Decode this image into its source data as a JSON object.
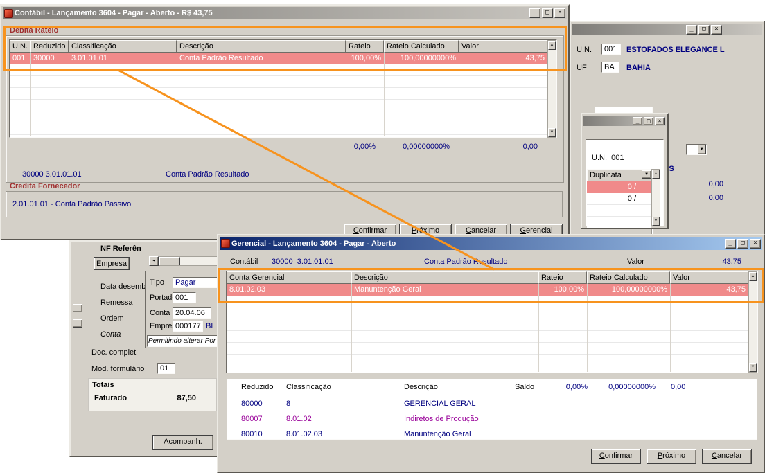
{
  "glyphs": {
    "minimize": "_",
    "maximize": "□",
    "close": "×",
    "up": "▲",
    "down": "▼",
    "left": "◄"
  },
  "colors": {
    "annotation": "#F7931E",
    "pink_row": "#F08A8A",
    "navy_text": "#000080",
    "purple_text": "#990099",
    "group_label_red": "#A03030",
    "window_bg": "#D4D0C8",
    "titlebar_active_start": "#0A246A",
    "titlebar_active_end": "#A6CAF0"
  },
  "contabil": {
    "title": "Contábil - Lançamento 3604 - Pagar - Aberto - R$ 43,75",
    "debita_label": "Debita Rateio",
    "headers": [
      "U.N.",
      "Reduzido",
      "Classificação",
      "Descrição",
      "Rateio",
      "Rateio Calculado",
      "Valor"
    ],
    "row": [
      "001",
      "30000",
      "3.01.01.01",
      "Conta Padrão Resultado",
      "100,00%",
      "100,00000000%",
      "43,75"
    ],
    "totals": [
      "0,00%",
      "0,00000000%",
      "0,00"
    ],
    "selected_code": "30000 3.01.01.01",
    "selected_desc": "Conta Padrão Resultado",
    "credita_label": "Credita Fornecedor",
    "credita_value": "2.01.01.01 - Conta Padrão Passivo",
    "buttons": [
      "Confirmar",
      "Próximo",
      "Cancelar",
      "Gerencial"
    ]
  },
  "gerencial": {
    "title": "Gerencial -  Lançamento 3604 - Pagar - Aberto",
    "contabil_label": "Contábil",
    "contabil_code": "30000  3.01.01.01",
    "contabil_desc": "Conta Padrão Resultado",
    "valor_label": "Valor",
    "valor_value": "43,75",
    "headers": [
      "Conta Gerencial",
      "Descrição",
      "Rateio",
      "Rateio Calculado",
      "Valor"
    ],
    "row": [
      "8.01.02.03",
      "Manuntenção Geral",
      "100,00%",
      "100,00000000%",
      "43,75"
    ],
    "totals": [
      "0,00%",
      "0,00000000%",
      "0,00"
    ],
    "lookup_headers": [
      "Reduzido",
      "Classificação",
      "Descrição",
      "Saldo"
    ],
    "lookup_rows": [
      {
        "reduzido": "80000",
        "classificacao": "8",
        "descricao": "GERENCIAL GERAL"
      },
      {
        "reduzido": "80007",
        "classificacao": "8.01.02",
        "descricao": "Indiretos de Produção"
      },
      {
        "reduzido": "80010",
        "classificacao": "8.01.02.03",
        "descricao": "Manuntenção Geral"
      }
    ],
    "buttons": [
      "Confirmar",
      "Próximo",
      "Cancelar"
    ]
  },
  "fornecedor": {
    "un_label": "U.N.",
    "un_code": "001",
    "un_name": "ESTOFADOS ELEGANCE L",
    "uf_label": "UF",
    "uf_code": "BA",
    "uf_name": "BAHIA",
    "inss_label": "INSS",
    "inss_value_1": "0,00",
    "inss_value_2": "0,00"
  },
  "duplicata": {
    "un_text": "U.N.  001",
    "header": "Duplicata",
    "row_1": "0 /",
    "row_2": "0 /"
  },
  "titulo": {
    "nf_label": "NF Referên",
    "empresa_tab": "Empresa",
    "labels": [
      "Data desemb",
      "Remessa",
      "Ordem",
      "Conta",
      "Doc. complet",
      "Mod. formulário"
    ],
    "mod_value": "01",
    "totais_label": "Totais",
    "faturado_label": "Faturado",
    "faturado_value": "87,50",
    "acompanh_button": "Acompanh.",
    "tipo_label": "Tipo",
    "tipo_value": "Pagar",
    "portador_label": "Portador",
    "portador_value": "001",
    "conta_label": "Conta",
    "conta_value": "20.04.06",
    "empresa_label": "Empresa",
    "empresa_value": "000177",
    "empresa_name": "BL",
    "note": "Permitindo alterar Por"
  }
}
